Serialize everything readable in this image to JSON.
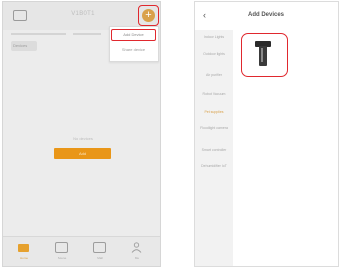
{
  "left_screen": {
    "header": {
      "title": "V1B0T1",
      "add_icon": "plus-icon",
      "left_icon": "grid-icon"
    },
    "room_chip": "Devices",
    "dropdown": {
      "items": [
        "Add Device",
        "Share device"
      ]
    },
    "empty_text": "No devices",
    "add_button_label": "Add",
    "bottom_nav": [
      {
        "label": "Home",
        "icon": "home-icon"
      },
      {
        "label": "Scene",
        "icon": "scene-icon"
      },
      {
        "label": "Mall",
        "icon": "mall-icon"
      },
      {
        "label": "Me",
        "icon": "user-icon"
      }
    ],
    "colors": {
      "accent": "#e99618",
      "highlight": "#e0282e"
    }
  },
  "right_screen": {
    "back_icon": "chevron-left-icon",
    "title": "Add Devices",
    "categories": [
      "Indoor Lights",
      "Outdoor lights",
      "Air purifier",
      "Robot Vacuum",
      "Pet supplies",
      "Floodlight camera",
      "Smart controller",
      "Dehumidifier IoT"
    ],
    "active_category_index": 4,
    "selected_device_icon": "purifier-device-icon",
    "colors": {
      "active_category": "#d9a14a",
      "highlight": "#e0282e"
    }
  }
}
